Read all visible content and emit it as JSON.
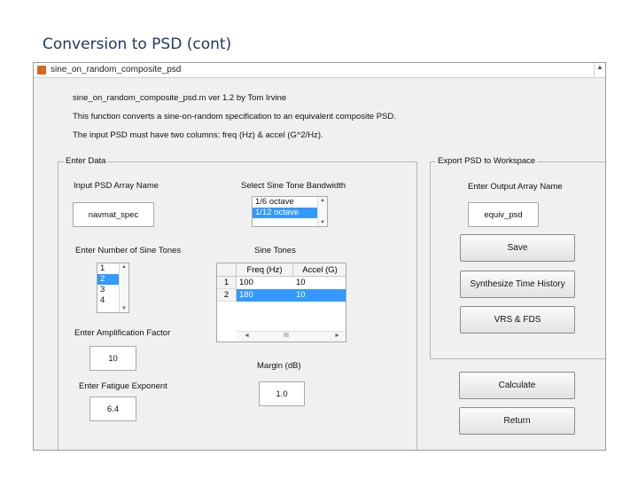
{
  "slide": {
    "title": "Conversion to PSD (cont)"
  },
  "window": {
    "title": "sine_on_random_composite_psd",
    "scroll_glyph": "▲"
  },
  "intro": {
    "line1": "sine_on_random_composite_psd.m  ver 1.2  by Tom Irvine",
    "line2": "This function converts a sine-on-random specification to an equivalent composite PSD.",
    "line3": "The input PSD must have two columns:  freq (Hz) & accel (G^2/Hz)."
  },
  "enter_data": {
    "title": "Enter Data",
    "psd_label": "Input PSD Array Name",
    "psd_value": "navmat_spec",
    "bandwidth_label": "Select Sine Tone Bandwidth",
    "bandwidth_options": [
      "1/6 octave",
      "1/12 octave"
    ],
    "bandwidth_selected": "1/12 octave",
    "num_tones_label": "Enter Number of Sine Tones",
    "num_tones_options": [
      "1",
      "2",
      "3",
      "4"
    ],
    "num_tones_selected": "2",
    "sine_tones_label": "Sine Tones",
    "table": {
      "headers": [
        "Freq (Hz)",
        "Accel (G)"
      ],
      "row_numbers": [
        "1",
        "2"
      ],
      "rows": [
        [
          "100",
          "10"
        ],
        [
          "180",
          "10"
        ]
      ]
    },
    "scroll_up": "▲",
    "scroll_down": "▼",
    "scroll_left": "◄",
    "scroll_right": "►",
    "scroll_thumb": "III",
    "amp_label": "Enter Amplification Factor",
    "amp_value": "10",
    "fatigue_label": "Enter Fatigue Exponent",
    "fatigue_value": "6.4",
    "margin_label": "Margin (dB)",
    "margin_value": "1.0"
  },
  "export": {
    "title": "Export PSD to Workspace",
    "output_label": "Enter Output Array Name",
    "output_value": "equiv_psd",
    "save": "Save",
    "synthesize": "Synthesize Time History",
    "vrs": "VRS & FDS"
  },
  "buttons": {
    "calculate": "Calculate",
    "return": "Return"
  }
}
